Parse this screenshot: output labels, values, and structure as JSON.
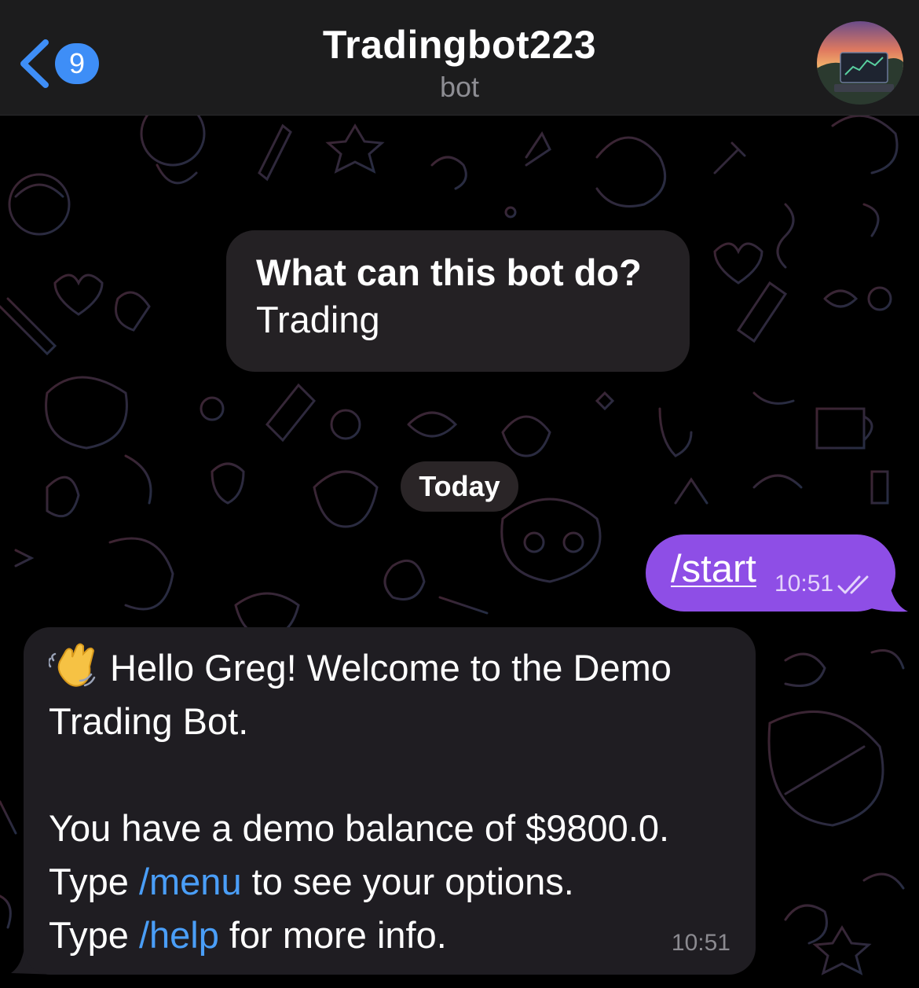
{
  "header": {
    "back_count": "9",
    "title": "Tradingbot223",
    "subtitle": "bot"
  },
  "info_card": {
    "title": "What can this bot do?",
    "text": "Trading"
  },
  "date_separator": "Today",
  "messages": {
    "outgoing": {
      "text": "/start",
      "time": "10:51",
      "status": "read"
    },
    "incoming": {
      "line1": "Hello Greg! Welcome to the Demo Trading Bot.",
      "line2": "You have a demo balance of $9800.0.",
      "line3_prefix": "Type ",
      "line3_command": "/menu",
      "line3_suffix": " to see your options.",
      "line4_prefix": "Type ",
      "line4_command": "/help",
      "line4_suffix": " for more info.",
      "time": "10:51"
    }
  },
  "colors": {
    "header_bg": "#1c1c1d",
    "accent_blue": "#3e8ef7",
    "outgoing_bubble": "#8e4ee6",
    "incoming_bubble": "#1f1d22",
    "link": "#4a9ef8"
  },
  "icons": {
    "back": "chevron-left-icon",
    "read_status": "double-check-icon",
    "greeting": "waving-hand-emoji"
  }
}
